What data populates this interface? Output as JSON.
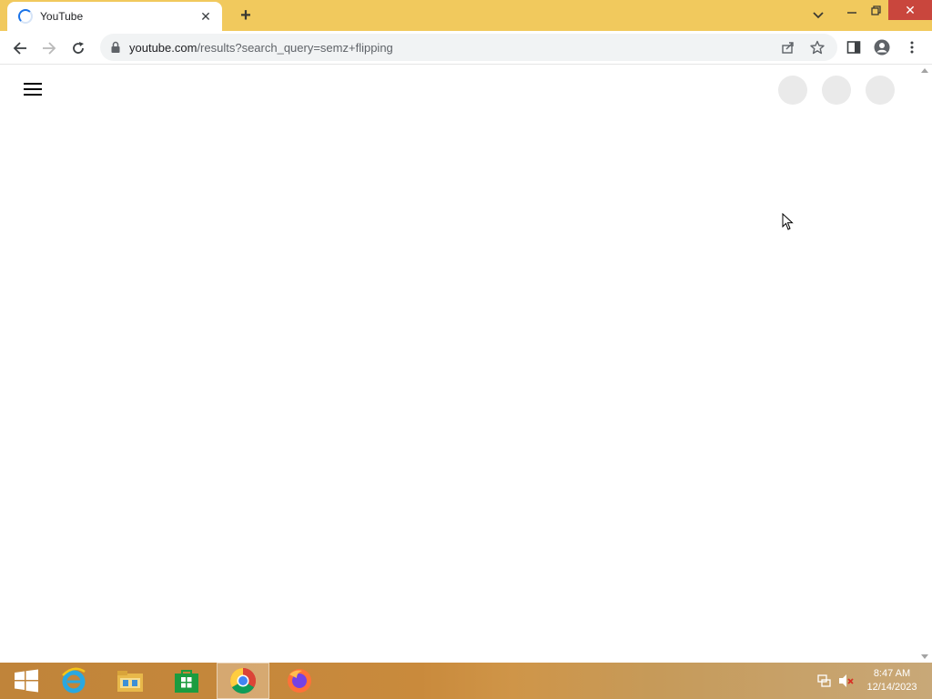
{
  "browser": {
    "tab": {
      "title": "YouTube",
      "state": "loading"
    },
    "address_bar": {
      "host": "youtube.com",
      "path": "/results?search_query=semz+flipping"
    }
  },
  "page": {
    "state": "loading-skeleton"
  },
  "taskbar": {
    "apps": [
      "start-button",
      "internet-explorer",
      "file-explorer",
      "store",
      "chrome",
      "firefox"
    ],
    "active_app": "chrome",
    "clock": {
      "time": "8:47 AM",
      "date": "12/14/2023"
    }
  },
  "colors": {
    "tabstrip": "#f1c95d",
    "omnibox": "#f1f3f4",
    "skeleton": "#eaeaea",
    "close_button": "#c9463d"
  }
}
